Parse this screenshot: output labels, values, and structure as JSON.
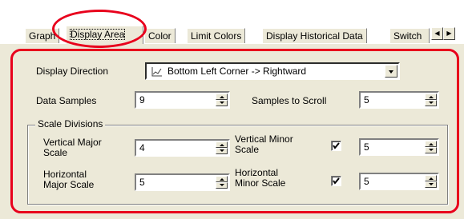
{
  "tabs": [
    {
      "label": "Graph"
    },
    {
      "label": "Display Area",
      "selected": true
    },
    {
      "label": "Color"
    },
    {
      "label": "Limit Colors"
    },
    {
      "label": "Display Historical Data"
    },
    {
      "label": "Switch"
    }
  ],
  "tab_scroll": {
    "left_icon": "scroll-left-icon",
    "right_icon": "scroll-right-icon"
  },
  "display_direction": {
    "label": "Display Direction",
    "value": "Bottom Left Corner -> Rightward",
    "icon": "line-graph-icon"
  },
  "data_samples": {
    "label": "Data Samples",
    "value": "9"
  },
  "samples_to_scroll": {
    "label": "Samples to Scroll",
    "value": "5"
  },
  "scale_divisions": {
    "title": "Scale Divisions",
    "vertical_major": {
      "label_line1": "Vertical Major",
      "label_line2": "Scale",
      "value": "4"
    },
    "vertical_minor": {
      "label_line1": "Vertical Minor",
      "label_line2": "Scale",
      "checked": true,
      "value": "5"
    },
    "horizontal_major": {
      "label_line1": "Horizontal",
      "label_line2": "Major Scale",
      "value": "5"
    },
    "horizontal_minor": {
      "label_line1": "Horizontal",
      "label_line2": "Minor Scale",
      "checked": true,
      "value": "5"
    }
  },
  "colors": {
    "highlight_red": "#e8001c",
    "panel_bg": "#ece9d8"
  }
}
